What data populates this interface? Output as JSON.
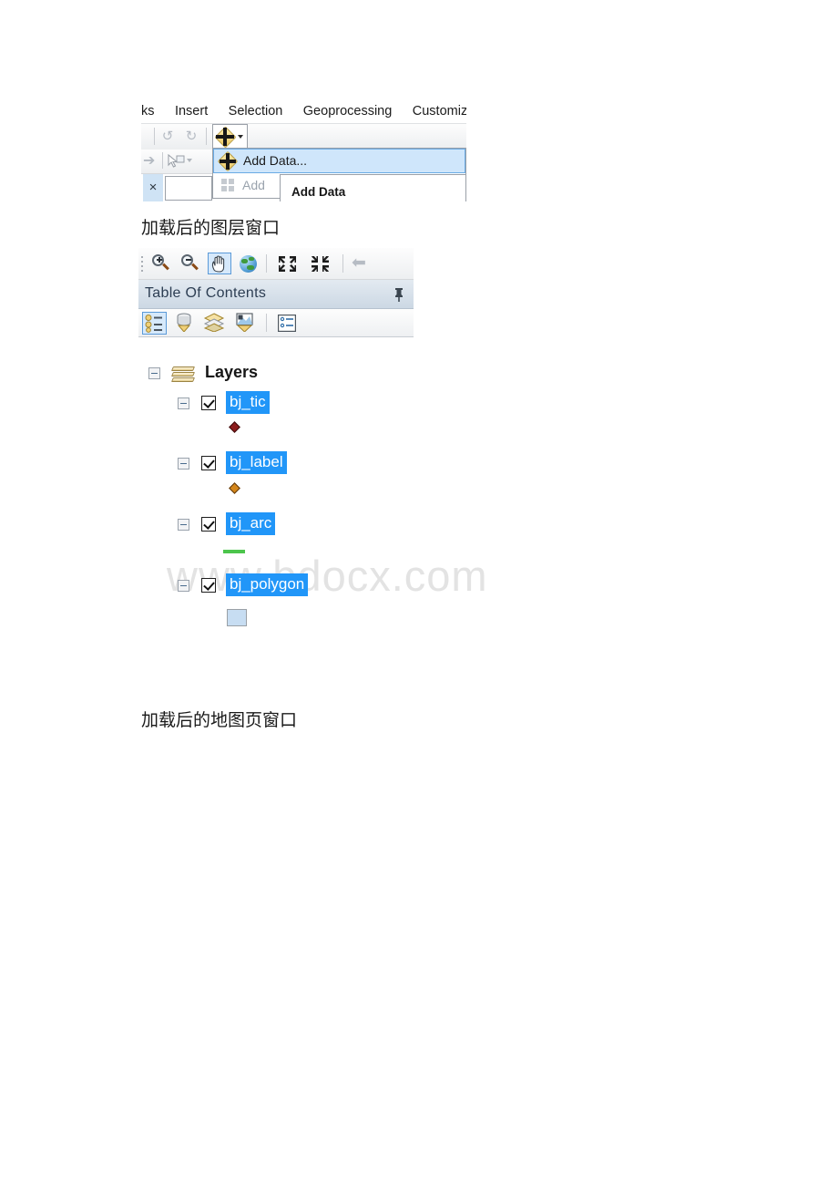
{
  "document": {
    "background": "#ffffff",
    "watermark": "www.bdocx.com"
  },
  "figure_add_data": {
    "menubar": {
      "items": [
        {
          "label": "ks"
        },
        {
          "label": "Insert"
        },
        {
          "label": "Selection"
        },
        {
          "label": "Geoprocessing"
        },
        {
          "label": "Customize"
        }
      ]
    },
    "toolbar": {
      "undo_icon": "undo-icon",
      "redo_icon": "redo-icon",
      "add_data_button": "add-data-button",
      "combo_value": "",
      "combo_placeholder": "",
      "editor_icon": "editor-tool-icon",
      "table_icon": "attribute-table-icon",
      "arrow_icon": "forward-arrow-icon",
      "select_icon": "select-features-icon",
      "close_label": "×"
    },
    "dropdown": {
      "items": [
        {
          "label": "Add Data...",
          "icon": "add-data-icon",
          "selected": true,
          "dimmed": false
        },
        {
          "label": "Add",
          "icon": "add-basemap-icon",
          "selected": false,
          "dimmed": true
        }
      ]
    },
    "tooltip": {
      "title": "Add Data"
    }
  },
  "caption_layers": "加载后的图层窗口",
  "caption_map": "加载后的地图页窗口",
  "figure_toc": {
    "nav_toolbar": {
      "buttons": [
        {
          "name": "zoom-in-icon",
          "active": false
        },
        {
          "name": "zoom-out-icon",
          "active": false
        },
        {
          "name": "pan-hand-icon",
          "active": true
        },
        {
          "name": "full-extent-globe-icon",
          "active": false
        },
        {
          "name": "fixed-zoom-in-icon",
          "active": false
        },
        {
          "name": "fixed-zoom-out-icon",
          "active": false
        },
        {
          "name": "go-back-extent-icon",
          "active": false
        }
      ]
    },
    "title": "Table Of Contents",
    "pin_icon": "pin-icon",
    "toc_tools": [
      {
        "name": "list-by-drawing-order-icon",
        "active": true
      },
      {
        "name": "list-by-source-icon",
        "active": false
      },
      {
        "name": "list-by-visibility-icon",
        "active": false
      },
      {
        "name": "list-by-selection-icon",
        "active": false
      },
      {
        "name": "options-icon",
        "active": false
      }
    ]
  },
  "layer_tree": {
    "root": {
      "label": "Layers",
      "icon": "data-frame-layers-icon",
      "expander": "collapse-icon"
    },
    "layers": [
      {
        "name": "bj_tic",
        "checked": true,
        "expander": "collapse-icon",
        "symbol": {
          "type": "point-diamond",
          "color": "#8c1c1c",
          "border": "#3a0a0a"
        }
      },
      {
        "name": "bj_label",
        "checked": true,
        "expander": "collapse-icon",
        "symbol": {
          "type": "point-diamond",
          "color": "#d4861a",
          "border": "#5c3509"
        }
      },
      {
        "name": "bj_arc",
        "checked": true,
        "expander": "collapse-icon",
        "symbol": {
          "type": "line",
          "color": "#4cc54c",
          "border": "#4cc54c"
        }
      },
      {
        "name": "bj_polygon",
        "checked": true,
        "expander": "collapse-icon",
        "symbol": {
          "type": "polygon",
          "color": "#c7ddf2",
          "border": "#9aa0a6"
        }
      }
    ]
  }
}
